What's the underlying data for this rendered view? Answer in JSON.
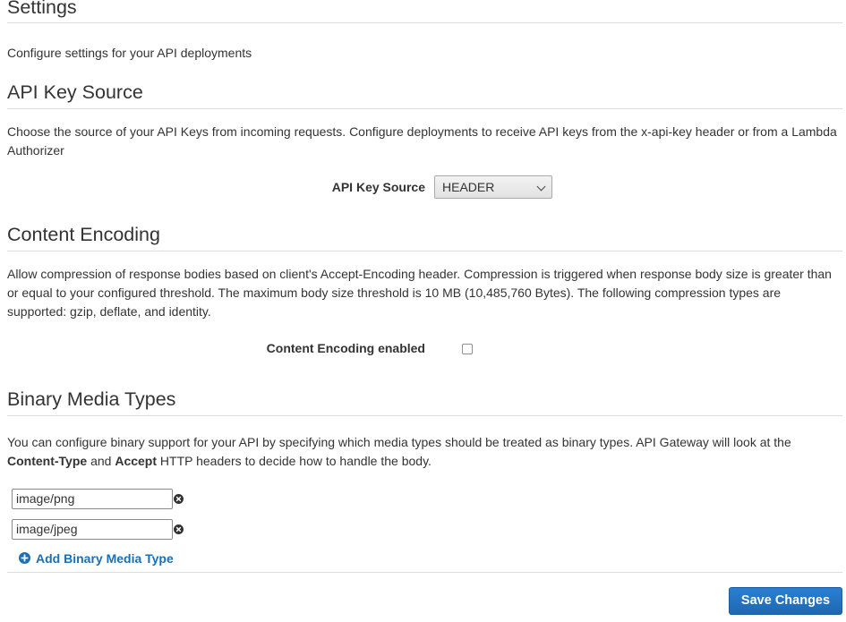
{
  "settings": {
    "title": "Settings",
    "description": "Configure settings for your API deployments"
  },
  "api_key_source": {
    "title": "API Key Source",
    "description": "Choose the source of your API Keys from incoming requests. Configure deployments to receive API keys from the x-api-key header or from a Lambda Authorizer",
    "field_label": "API Key Source",
    "selected_value": "HEADER"
  },
  "content_encoding": {
    "title": "Content Encoding",
    "description": "Allow compression of response bodies based on client's Accept-Encoding header. Compression is triggered when response body size is greater than or equal to your configured threshold. The maximum body size threshold is 10 MB (10,485,760 Bytes). The following compression types are supported: gzip, deflate, and identity.",
    "field_label": "Content Encoding enabled",
    "enabled": false
  },
  "binary_media_types": {
    "title": "Binary Media Types",
    "description_part1": "You can configure binary support for your API by specifying which media types should be treated as binary types. API Gateway will look at the ",
    "description_bold1": "Content-Type",
    "description_part2": " and ",
    "description_bold2": "Accept",
    "description_part3": " HTTP headers to decide how to handle the body.",
    "types": [
      "image/png",
      "image/jpeg"
    ],
    "add_label": "Add Binary Media Type"
  },
  "actions": {
    "save_label": "Save Changes"
  },
  "colors": {
    "link": "#1a6fb5",
    "primary_button": "#1e68b3",
    "divider": "#dddddd"
  },
  "icons": {
    "remove": "remove-circle-icon",
    "add": "plus-circle-icon",
    "dropdown": "chevron-down-icon"
  }
}
